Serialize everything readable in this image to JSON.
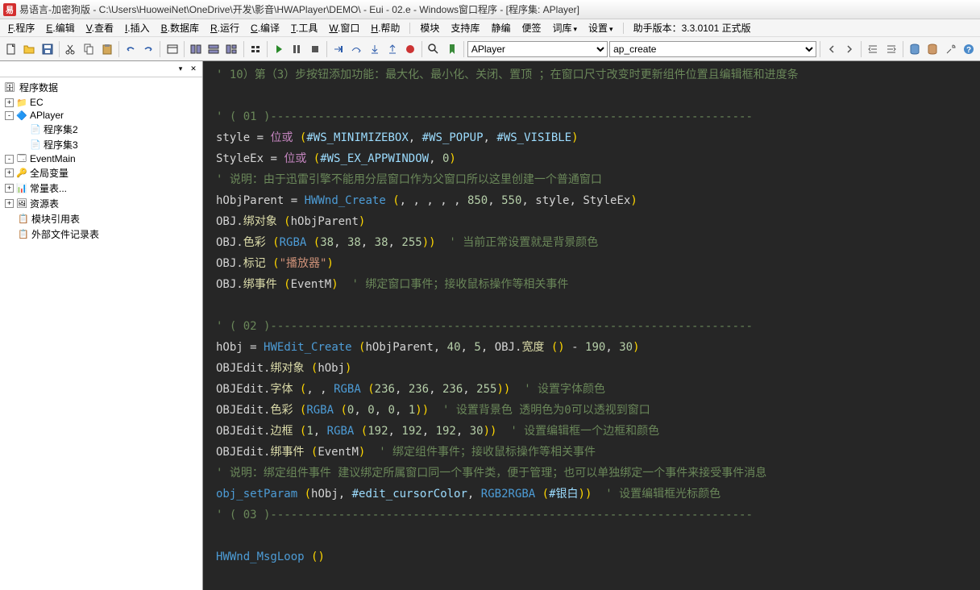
{
  "title": "易语言-加密狗版 - C:\\Users\\HuoweiNet\\OneDrive\\开发\\影音\\HWAPlayer\\DEMO\\ - Eui - 02.e - Windows窗口程序 - [程序集: APlayer]",
  "menus": [
    {
      "u": "F",
      "label": ".程序"
    },
    {
      "u": "E",
      "label": ".编辑"
    },
    {
      "u": "V",
      "label": ".查看"
    },
    {
      "u": "I",
      "label": ".插入"
    },
    {
      "u": "B",
      "label": ".数据库"
    },
    {
      "u": "R",
      "label": ".运行"
    },
    {
      "u": "C",
      "label": ".编译"
    },
    {
      "u": "T",
      "label": ".工具"
    },
    {
      "u": "W",
      "label": ".窗口"
    },
    {
      "u": "H",
      "label": ".帮助"
    }
  ],
  "menu_extras": [
    "模块",
    "支持库",
    "静编",
    "便签"
  ],
  "menu_dropdowns": [
    "词库",
    "设置"
  ],
  "assistant_version_label": "助手版本：",
  "assistant_version_value": "3.3.0101 正式版",
  "combo1": "APlayer",
  "combo2": "ap_create",
  "sidebar_title": "程序数据",
  "tree": [
    {
      "indent": 0,
      "toggle": "+",
      "icon": "📁",
      "label": "EC"
    },
    {
      "indent": 0,
      "toggle": "-",
      "icon": "🔷",
      "label": "APlayer"
    },
    {
      "indent": 1,
      "toggle": "",
      "icon": "📄",
      "label": "程序集2"
    },
    {
      "indent": 1,
      "toggle": "",
      "icon": "📄",
      "label": "程序集3"
    },
    {
      "indent": 0,
      "toggle": "-",
      "icon": "🗔",
      "label": "EventMain"
    },
    {
      "indent": 0,
      "toggle": "+",
      "icon": "🔑",
      "label": "全局变量"
    },
    {
      "indent": 0,
      "toggle": "+",
      "icon": "📊",
      "label": "常量表..."
    },
    {
      "indent": 0,
      "toggle": "+",
      "icon": "🖼",
      "label": "资源表"
    },
    {
      "indent": 0,
      "toggle": "",
      "icon": "📋",
      "label": "模块引用表"
    },
    {
      "indent": 0,
      "toggle": "",
      "icon": "📋",
      "label": "外部文件记录表"
    }
  ],
  "code": [
    {
      "type": "comment",
      "text": "' 10）第（3）步按钮添加功能：最大化、最小化、关闭、置顶 ；在窗口尺寸改变时更新组件位置且编辑框和进度条"
    },
    {
      "type": "blank"
    },
    {
      "type": "comment",
      "text": "' ( 01 )-----------------------------------------------------------------------"
    },
    {
      "type": "line",
      "tokens": [
        [
          "ident",
          "style"
        ],
        [
          "sp",
          " "
        ],
        [
          "op",
          "="
        ],
        [
          "sp",
          " "
        ],
        [
          "kw",
          "位或"
        ],
        [
          "sp",
          " "
        ],
        [
          "paren",
          "("
        ],
        [
          "const",
          "#WS_MINIMIZEBOX"
        ],
        [
          "op",
          ","
        ],
        [
          "sp",
          " "
        ],
        [
          "const",
          "#WS_POPUP"
        ],
        [
          "op",
          ","
        ],
        [
          "sp",
          " "
        ],
        [
          "const",
          "#WS_VISIBLE"
        ],
        [
          "paren",
          ")"
        ]
      ]
    },
    {
      "type": "line",
      "tokens": [
        [
          "ident",
          "StyleEx"
        ],
        [
          "sp",
          " "
        ],
        [
          "op",
          "="
        ],
        [
          "sp",
          " "
        ],
        [
          "kw",
          "位或"
        ],
        [
          "sp",
          " "
        ],
        [
          "paren",
          "("
        ],
        [
          "const",
          "#WS_EX_APPWINDOW"
        ],
        [
          "op",
          ","
        ],
        [
          "sp",
          " "
        ],
        [
          "num",
          "0"
        ],
        [
          "paren",
          ")"
        ]
      ]
    },
    {
      "type": "comment",
      "text": "' 说明：由于迅雷引擎不能用分层窗口作为父窗口所以这里创建一个普通窗口"
    },
    {
      "type": "line",
      "tokens": [
        [
          "ident",
          "hObjParent"
        ],
        [
          "sp",
          " "
        ],
        [
          "op",
          "="
        ],
        [
          "sp",
          " "
        ],
        [
          "func",
          "HWWnd_Create"
        ],
        [
          "sp",
          " "
        ],
        [
          "paren",
          "("
        ],
        [
          "op",
          ", , , , ,"
        ],
        [
          "sp",
          " "
        ],
        [
          "num",
          "850"
        ],
        [
          "op",
          ","
        ],
        [
          "sp",
          " "
        ],
        [
          "num",
          "550"
        ],
        [
          "op",
          ","
        ],
        [
          "sp",
          " "
        ],
        [
          "ident",
          "style"
        ],
        [
          "op",
          ","
        ],
        [
          "sp",
          " "
        ],
        [
          "ident",
          "StyleEx"
        ],
        [
          "paren",
          ")"
        ]
      ]
    },
    {
      "type": "line",
      "tokens": [
        [
          "ident",
          "OBJ"
        ],
        [
          "op",
          "."
        ],
        [
          "method",
          "绑对象"
        ],
        [
          "sp",
          " "
        ],
        [
          "paren",
          "("
        ],
        [
          "ident",
          "hObjParent"
        ],
        [
          "paren",
          ")"
        ]
      ]
    },
    {
      "type": "line",
      "tokens": [
        [
          "ident",
          "OBJ"
        ],
        [
          "op",
          "."
        ],
        [
          "method",
          "色彩"
        ],
        [
          "sp",
          " "
        ],
        [
          "paren",
          "("
        ],
        [
          "func",
          "RGBA"
        ],
        [
          "sp",
          " "
        ],
        [
          "paren",
          "("
        ],
        [
          "num",
          "38"
        ],
        [
          "op",
          ","
        ],
        [
          "sp",
          " "
        ],
        [
          "num",
          "38"
        ],
        [
          "op",
          ","
        ],
        [
          "sp",
          " "
        ],
        [
          "num",
          "38"
        ],
        [
          "op",
          ","
        ],
        [
          "sp",
          " "
        ],
        [
          "num",
          "255"
        ],
        [
          "paren",
          "))"
        ],
        [
          "sp",
          "  "
        ],
        [
          "comment",
          "' 当前正常设置就是背景颜色"
        ]
      ]
    },
    {
      "type": "line",
      "tokens": [
        [
          "ident",
          "OBJ"
        ],
        [
          "op",
          "."
        ],
        [
          "method",
          "标记"
        ],
        [
          "sp",
          " "
        ],
        [
          "paren",
          "("
        ],
        [
          "str",
          "\"播放器\""
        ],
        [
          "paren",
          ")"
        ]
      ]
    },
    {
      "type": "line",
      "tokens": [
        [
          "ident",
          "OBJ"
        ],
        [
          "op",
          "."
        ],
        [
          "method",
          "绑事件"
        ],
        [
          "sp",
          " "
        ],
        [
          "paren",
          "("
        ],
        [
          "ident",
          "EventM"
        ],
        [
          "paren",
          ")"
        ],
        [
          "sp",
          "  "
        ],
        [
          "comment",
          "' 绑定窗口事件；接收鼠标操作等相关事件"
        ]
      ]
    },
    {
      "type": "blank"
    },
    {
      "type": "comment",
      "text": "' ( 02 )-----------------------------------------------------------------------"
    },
    {
      "type": "line",
      "tokens": [
        [
          "ident",
          "hObj"
        ],
        [
          "sp",
          " "
        ],
        [
          "op",
          "="
        ],
        [
          "sp",
          " "
        ],
        [
          "func",
          "HWEdit_Create"
        ],
        [
          "sp",
          " "
        ],
        [
          "paren",
          "("
        ],
        [
          "ident",
          "hObjParent"
        ],
        [
          "op",
          ","
        ],
        [
          "sp",
          " "
        ],
        [
          "num",
          "40"
        ],
        [
          "op",
          ","
        ],
        [
          "sp",
          " "
        ],
        [
          "num",
          "5"
        ],
        [
          "op",
          ","
        ],
        [
          "sp",
          " "
        ],
        [
          "ident",
          "OBJ"
        ],
        [
          "op",
          "."
        ],
        [
          "method",
          "宽度"
        ],
        [
          "sp",
          " "
        ],
        [
          "paren",
          "()"
        ],
        [
          "sp",
          " "
        ],
        [
          "op",
          "-"
        ],
        [
          "sp",
          " "
        ],
        [
          "num",
          "190"
        ],
        [
          "op",
          ","
        ],
        [
          "sp",
          " "
        ],
        [
          "num",
          "30"
        ],
        [
          "paren",
          ")"
        ]
      ]
    },
    {
      "type": "line",
      "tokens": [
        [
          "ident",
          "OBJEdit"
        ],
        [
          "op",
          "."
        ],
        [
          "method",
          "绑对象"
        ],
        [
          "sp",
          " "
        ],
        [
          "paren",
          "("
        ],
        [
          "ident",
          "hObj"
        ],
        [
          "paren",
          ")"
        ]
      ]
    },
    {
      "type": "line",
      "tokens": [
        [
          "ident",
          "OBJEdit"
        ],
        [
          "op",
          "."
        ],
        [
          "method",
          "字体"
        ],
        [
          "sp",
          " "
        ],
        [
          "paren",
          "("
        ],
        [
          "op",
          ", ,"
        ],
        [
          "sp",
          " "
        ],
        [
          "func",
          "RGBA"
        ],
        [
          "sp",
          " "
        ],
        [
          "paren",
          "("
        ],
        [
          "num",
          "236"
        ],
        [
          "op",
          ","
        ],
        [
          "sp",
          " "
        ],
        [
          "num",
          "236"
        ],
        [
          "op",
          ","
        ],
        [
          "sp",
          " "
        ],
        [
          "num",
          "236"
        ],
        [
          "op",
          ","
        ],
        [
          "sp",
          " "
        ],
        [
          "num",
          "255"
        ],
        [
          "paren",
          "))"
        ],
        [
          "sp",
          "  "
        ],
        [
          "comment",
          "' 设置字体颜色"
        ]
      ]
    },
    {
      "type": "line",
      "tokens": [
        [
          "ident",
          "OBJEdit"
        ],
        [
          "op",
          "."
        ],
        [
          "method",
          "色彩"
        ],
        [
          "sp",
          " "
        ],
        [
          "paren",
          "("
        ],
        [
          "func",
          "RGBA"
        ],
        [
          "sp",
          " "
        ],
        [
          "paren",
          "("
        ],
        [
          "num",
          "0"
        ],
        [
          "op",
          ","
        ],
        [
          "sp",
          " "
        ],
        [
          "num",
          "0"
        ],
        [
          "op",
          ","
        ],
        [
          "sp",
          " "
        ],
        [
          "num",
          "0"
        ],
        [
          "op",
          ","
        ],
        [
          "sp",
          " "
        ],
        [
          "num",
          "1"
        ],
        [
          "paren",
          "))"
        ],
        [
          "sp",
          "  "
        ],
        [
          "comment",
          "' 设置背景色 透明色为0可以透视到窗口"
        ]
      ]
    },
    {
      "type": "line",
      "tokens": [
        [
          "ident",
          "OBJEdit"
        ],
        [
          "op",
          "."
        ],
        [
          "method",
          "边框"
        ],
        [
          "sp",
          " "
        ],
        [
          "paren",
          "("
        ],
        [
          "num",
          "1"
        ],
        [
          "op",
          ","
        ],
        [
          "sp",
          " "
        ],
        [
          "func",
          "RGBA"
        ],
        [
          "sp",
          " "
        ],
        [
          "paren",
          "("
        ],
        [
          "num",
          "192"
        ],
        [
          "op",
          ","
        ],
        [
          "sp",
          " "
        ],
        [
          "num",
          "192"
        ],
        [
          "op",
          ","
        ],
        [
          "sp",
          " "
        ],
        [
          "num",
          "192"
        ],
        [
          "op",
          ","
        ],
        [
          "sp",
          " "
        ],
        [
          "num",
          "30"
        ],
        [
          "paren",
          "))"
        ],
        [
          "sp",
          "  "
        ],
        [
          "comment",
          "' 设置编辑框一个边框和颜色"
        ]
      ]
    },
    {
      "type": "line",
      "tokens": [
        [
          "ident",
          "OBJEdit"
        ],
        [
          "op",
          "."
        ],
        [
          "method",
          "绑事件"
        ],
        [
          "sp",
          " "
        ],
        [
          "paren",
          "("
        ],
        [
          "ident",
          "EventM"
        ],
        [
          "paren",
          ")"
        ],
        [
          "sp",
          "  "
        ],
        [
          "comment",
          "' 绑定组件事件；接收鼠标操作等相关事件"
        ]
      ]
    },
    {
      "type": "comment",
      "text": "' 说明：绑定组件事件 建议绑定所属窗口同一个事件类，便于管理；也可以单独绑定一个事件来接受事件消息"
    },
    {
      "type": "line",
      "tokens": [
        [
          "func",
          "obj_setParam"
        ],
        [
          "sp",
          " "
        ],
        [
          "paren",
          "("
        ],
        [
          "ident",
          "hObj"
        ],
        [
          "op",
          ","
        ],
        [
          "sp",
          " "
        ],
        [
          "const",
          "#edit_cursorColor"
        ],
        [
          "op",
          ","
        ],
        [
          "sp",
          " "
        ],
        [
          "func",
          "RGB2RGBA"
        ],
        [
          "sp",
          " "
        ],
        [
          "paren",
          "("
        ],
        [
          "const",
          "#银白"
        ],
        [
          "paren",
          "))"
        ],
        [
          "sp",
          "  "
        ],
        [
          "comment",
          "' 设置编辑框光标颜色"
        ]
      ]
    },
    {
      "type": "comment",
      "text": "' ( 03 )-----------------------------------------------------------------------"
    },
    {
      "type": "blank"
    },
    {
      "type": "line",
      "tokens": [
        [
          "func",
          "HWWnd_MsgLoop"
        ],
        [
          "sp",
          " "
        ],
        [
          "paren",
          "()"
        ]
      ]
    }
  ]
}
